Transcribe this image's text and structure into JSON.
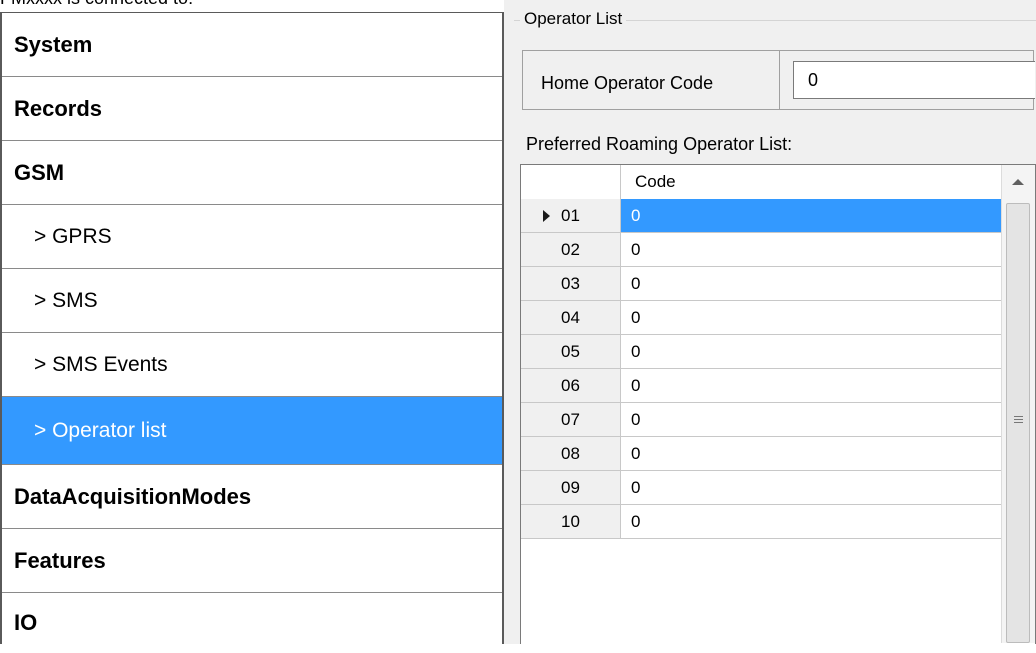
{
  "top_cut_text": "FMxxxx is connected to:",
  "sidebar": {
    "items": [
      {
        "label": "System",
        "level": "top"
      },
      {
        "label": "Records",
        "level": "top"
      },
      {
        "label": "GSM",
        "level": "top"
      },
      {
        "label": "> GPRS",
        "level": "sub"
      },
      {
        "label": "> SMS",
        "level": "sub"
      },
      {
        "label": "> SMS Events",
        "level": "sub"
      },
      {
        "label": "> Operator list",
        "level": "sub",
        "selected": true
      },
      {
        "label": "DataAcquisitionModes",
        "level": "top"
      },
      {
        "label": "Features",
        "level": "top"
      },
      {
        "label": "IO",
        "level": "top"
      }
    ]
  },
  "operator_list": {
    "group_title": "Operator List",
    "home_operator_code_label": "Home Operator Code",
    "home_operator_code_value": "0",
    "preferred_label": "Preferred Roaming Operator List:",
    "grid": {
      "column_header": "Code",
      "rows": [
        {
          "index": "01",
          "code": "0",
          "selected": true
        },
        {
          "index": "02",
          "code": "0"
        },
        {
          "index": "03",
          "code": "0"
        },
        {
          "index": "04",
          "code": "0"
        },
        {
          "index": "05",
          "code": "0"
        },
        {
          "index": "06",
          "code": "0"
        },
        {
          "index": "07",
          "code": "0"
        },
        {
          "index": "08",
          "code": "0"
        },
        {
          "index": "09",
          "code": "0"
        },
        {
          "index": "10",
          "code": "0"
        }
      ]
    }
  },
  "colors": {
    "selection": "#3399ff",
    "panel_background": "#f0f0f0"
  }
}
